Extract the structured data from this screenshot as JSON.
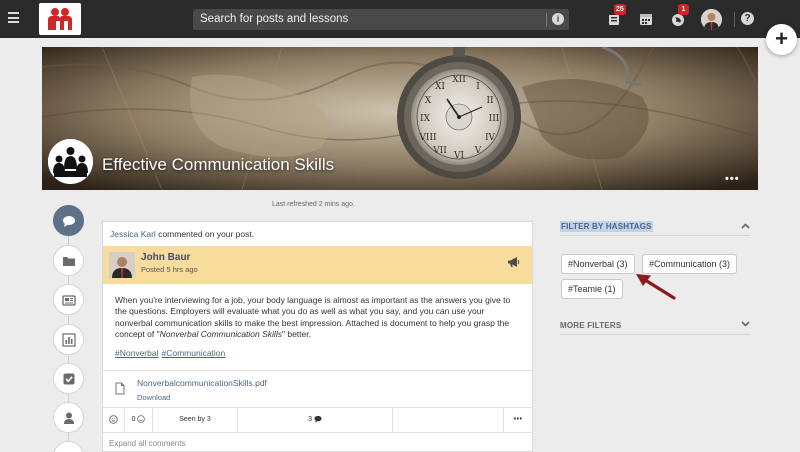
{
  "topbar": {
    "search_placeholder": "Search for posts and lessons",
    "notifications_count": "25",
    "world_count": "1"
  },
  "banner": {
    "title": "Effective Communication Skills",
    "more": "•••"
  },
  "feed": {
    "last_refreshed": "Last refreshed 2 mins ago.",
    "notification": {
      "actor": "Jessica Karl",
      "text": " commented on your post."
    },
    "post": {
      "author": "John Baur",
      "posted": "Posted 5 hrs ago",
      "body_1": "When you're interviewing for a job, your body language is almost as important as the answers you give to the questions. Employers will evaluate what you do as well as what you say, and you can use your nonverbal communication skills to make the best impression. Attached is document to help you grasp the concept of \"",
      "body_emph": "Nonverbal Communication Skills",
      "body_2": "\" better.",
      "hashtags": [
        "#Nonverbal",
        "#Communication"
      ],
      "attachment": {
        "name": "NonverbalcommunicationSkills.pdf",
        "action": "Download"
      },
      "actions": {
        "reactions": "0",
        "seen_by": "Seen by 3",
        "comments": "3",
        "more": "•••"
      },
      "expand": "Expand all comments"
    }
  },
  "sidebar": {
    "filter_title": "FILTER BY HASHTAGS",
    "tags": [
      "#Nonverbal (3)",
      "#Communication (3)",
      "#Teamie (1)"
    ],
    "more_filters": "MORE FILTERS"
  },
  "colors": {
    "topbar": "#2b2b2b",
    "accent": "#4a6587",
    "post_header": "#f7dc9c",
    "badge": "#d0252b",
    "arrow": "#8b1a1a"
  }
}
